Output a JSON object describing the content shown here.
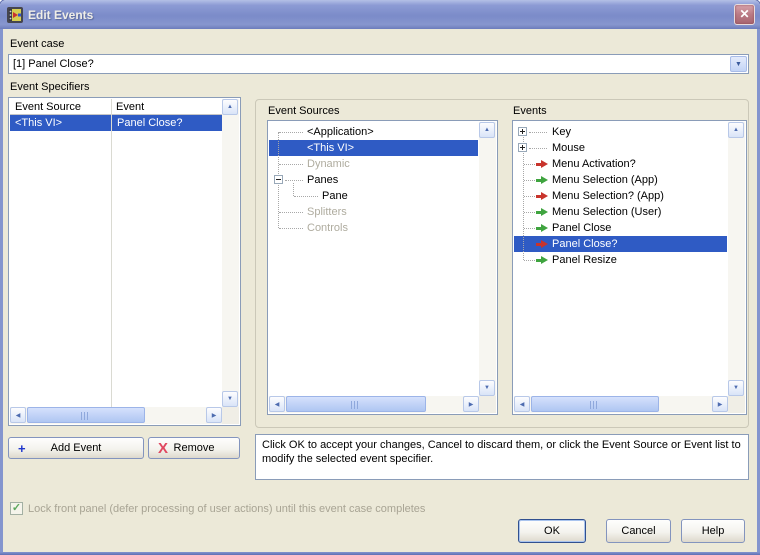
{
  "window": {
    "title": "Edit Events",
    "close_icon": "✕"
  },
  "event_case": {
    "label": "Event case",
    "value": "[1] Panel Close?"
  },
  "event_specifiers": {
    "label": "Event Specifiers",
    "columns": [
      "Event Source",
      "Event"
    ],
    "rows": [
      {
        "source": "<This VI>",
        "event": "Panel Close?",
        "selected": true
      }
    ]
  },
  "event_sources": {
    "label": "Event Sources",
    "items": [
      {
        "label": "<Application>",
        "state": "normal"
      },
      {
        "label": "<This VI>",
        "state": "selected"
      },
      {
        "label": "Dynamic",
        "state": "disabled"
      },
      {
        "label": "Panes",
        "state": "normal",
        "icon": "minus-expander"
      },
      {
        "label": "Pane",
        "state": "normal",
        "indent": 1
      },
      {
        "label": "Splitters",
        "state": "disabled"
      },
      {
        "label": "Controls",
        "state": "disabled"
      }
    ]
  },
  "events": {
    "label": "Events",
    "items": [
      {
        "label": "Key",
        "icon": "plus-expander"
      },
      {
        "label": "Mouse",
        "icon": "plus-expander"
      },
      {
        "label": "Menu Activation?",
        "icon": "filter-event-red-arrow"
      },
      {
        "label": "Menu Selection (App)",
        "icon": "notify-event-green-arrow"
      },
      {
        "label": "Menu Selection? (App)",
        "icon": "filter-event-red-arrow"
      },
      {
        "label": "Menu Selection (User)",
        "icon": "notify-event-green-arrow"
      },
      {
        "label": "Panel Close",
        "icon": "notify-event-green-arrow"
      },
      {
        "label": "Panel Close?",
        "icon": "filter-event-red-arrow",
        "selected": true
      },
      {
        "label": "Panel Resize",
        "icon": "notify-event-green-arrow"
      }
    ]
  },
  "buttons": {
    "add_event": "Add Event",
    "add_icon": "+",
    "remove": "Remove",
    "remove_icon": "X",
    "ok": "OK",
    "cancel": "Cancel",
    "help": "Help"
  },
  "info": {
    "text": "Click OK to accept your changes, Cancel to discard them, or click the Event Source or Event list to modify the selected event specifier."
  },
  "lock_checkbox": {
    "checked": true,
    "label": "Lock front panel (defer processing of user actions) until this event case completes"
  },
  "colors": {
    "selection_blue": "#2F5BC4",
    "notify_event_green": "#3FA43F",
    "filter_event_red": "#C8342C",
    "dialog_background": "#ECE9D8",
    "titlebar_blue": "#7B8BC9"
  }
}
